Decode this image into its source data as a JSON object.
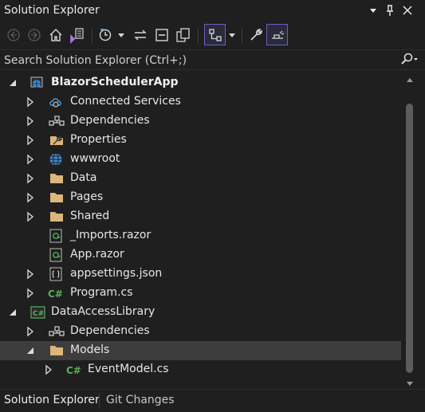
{
  "panel": {
    "title": "Solution Explorer",
    "controls": [
      {
        "name": "dropdown-icon"
      },
      {
        "name": "pin-icon"
      },
      {
        "name": "close-icon"
      }
    ]
  },
  "toolbar": {
    "buttons": [
      {
        "name": "back-icon"
      },
      {
        "name": "forward-icon"
      },
      {
        "name": "home-icon"
      },
      {
        "name": "switch-views-icon"
      },
      {
        "name": "pending-changes-filter-icon"
      },
      {
        "name": "sync-active-document-icon"
      },
      {
        "name": "collapse-all-icon"
      },
      {
        "name": "show-all-files-icon"
      },
      {
        "name": "preview-selected-items-icon"
      },
      {
        "name": "properties-icon"
      },
      {
        "name": "toggle-view-icon"
      }
    ]
  },
  "search": {
    "placeholder": "Search Solution Explorer (Ctrl+;)"
  },
  "tree": {
    "items": [
      {
        "label": "BlazorSchedulerApp",
        "level": 0,
        "expanded": true,
        "icon": "web-project-icon",
        "bold": true
      },
      {
        "label": "Connected Services",
        "level": 1,
        "expanded": false,
        "icon": "connected-services-icon"
      },
      {
        "label": "Dependencies",
        "level": 1,
        "expanded": false,
        "icon": "dependencies-icon"
      },
      {
        "label": "Properties",
        "level": 1,
        "expanded": false,
        "icon": "properties-wrench-icon"
      },
      {
        "label": "wwwroot",
        "level": 1,
        "expanded": false,
        "icon": "globe-icon"
      },
      {
        "label": "Data",
        "level": 1,
        "expanded": false,
        "icon": "folder-icon"
      },
      {
        "label": "Pages",
        "level": 1,
        "expanded": false,
        "icon": "folder-icon"
      },
      {
        "label": "Shared",
        "level": 1,
        "expanded": false,
        "icon": "folder-icon"
      },
      {
        "label": "_Imports.razor",
        "level": 1,
        "expanded": null,
        "icon": "razor-file-icon"
      },
      {
        "label": "App.razor",
        "level": 1,
        "expanded": null,
        "icon": "razor-file-icon"
      },
      {
        "label": "appsettings.json",
        "level": 1,
        "expanded": false,
        "icon": "json-file-icon"
      },
      {
        "label": "Program.cs",
        "level": 1,
        "expanded": false,
        "icon": "csharp-file-icon"
      },
      {
        "label": "DataAccessLibrary",
        "level": 0,
        "expanded": true,
        "icon": "csharp-project-icon"
      },
      {
        "label": "Dependencies",
        "level": 1,
        "expanded": false,
        "icon": "dependencies-icon"
      },
      {
        "label": "Models",
        "level": 1,
        "expanded": true,
        "icon": "folder-icon",
        "selected": true
      },
      {
        "label": "EventModel.cs",
        "level": 2,
        "expanded": false,
        "icon": "csharp-file-icon"
      }
    ]
  },
  "bottom_tabs": [
    {
      "label": "Solution Explorer",
      "active": true
    },
    {
      "label": "Git Changes",
      "active": false
    }
  ],
  "colors": {
    "background": "#1f1f1f",
    "selection": "#3d3d3d",
    "accent": "#6a5fc1",
    "folder": "#dcb67a",
    "csharp": "#57b05a"
  }
}
